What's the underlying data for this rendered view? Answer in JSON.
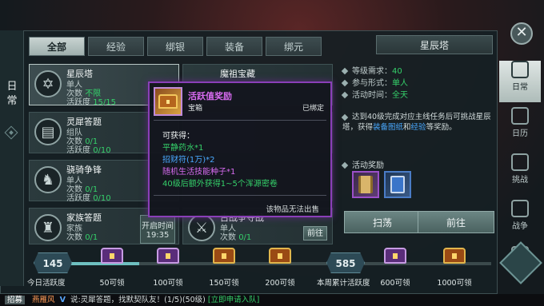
{
  "sidebar_title": "日常",
  "close_label": "✕",
  "tabs": [
    {
      "label": "全部",
      "active": true
    },
    {
      "label": "经验",
      "active": false
    },
    {
      "label": "绑银",
      "active": false
    },
    {
      "label": "装备",
      "active": false
    },
    {
      "label": "绑元",
      "active": false
    }
  ],
  "activities": [
    {
      "icon": "hexagram-icon",
      "glyph": "✡",
      "title": "星辰塔",
      "type": "单人",
      "count_label": "次数",
      "count": "不限",
      "act_label": "活跃度",
      "act": "15/15"
    },
    {
      "icon": "book-icon",
      "glyph": "📖",
      "title": "灵犀答题",
      "type": "组队",
      "count_label": "次数",
      "count": "0/1",
      "act_label": "活跃度",
      "act": "0/10"
    },
    {
      "icon": "horse-icon",
      "glyph": "♞",
      "title": "骁骑争锋",
      "type": "单人",
      "count_label": "次数",
      "count": "0/1",
      "act_label": "活跃度",
      "act": "0/10"
    },
    {
      "icon": "helmet-icon",
      "glyph": "♜",
      "title": "家族答题",
      "type": "家族",
      "count_label": "次数",
      "count": "0/1",
      "act_label": "活跃度",
      "act": "0/10",
      "time": "19:35"
    },
    {
      "title": "魔祖宝藏"
    },
    {
      "title": "古战争夺战",
      "type": "单人",
      "count_label": "次数",
      "count": "0/1"
    }
  ],
  "card_time_label": "开启时间",
  "go_label": "前往",
  "popup": {
    "name": "活跃值奖励",
    "type": "宝箱",
    "bound": "已绑定",
    "obtain_label": "可获得：",
    "rewards": [
      {
        "text": "平静药水*1",
        "color": "#35d06a"
      },
      {
        "text": "招财符(1万)*2",
        "color": "#4aa9ff"
      },
      {
        "text": "随机生活技能种子*1",
        "color": "#d76bf0"
      },
      {
        "text": "40级后额外获得1~5个浑源密卷",
        "color": "#35d06a"
      }
    ],
    "no_sell": "该物品无法出售"
  },
  "detail": {
    "title": "星辰塔",
    "level_label": "等级需求：",
    "level": "40",
    "form_label": "参与形式：",
    "form": "单人",
    "time_label": "活动时间：",
    "time": "全天",
    "desc_pre": "达到40级完成对应主线任务后可挑战星辰塔，获得",
    "desc_hl1": "装备图纸",
    "desc_mid": "和",
    "desc_hl2": "经验",
    "desc_post": "等奖励。",
    "rewards_label": "活动奖励",
    "sweep": "扫荡",
    "go": "前往"
  },
  "nav": [
    {
      "label": "日常",
      "icon": "calendar-scroll-icon",
      "active": true
    },
    {
      "label": "日历",
      "icon": "calendar-icon",
      "active": false
    },
    {
      "label": "挑战",
      "icon": "swords-icon",
      "active": false
    },
    {
      "label": "战争",
      "icon": "banner-icon",
      "active": false
    },
    {
      "label": "争夺",
      "icon": "crown-icon",
      "active": false
    }
  ],
  "progress": {
    "today_score": "145",
    "today_label": "今日活跃度",
    "week_score": "585",
    "week_label": "本周累计活跃度",
    "today_chests": [
      "50可领",
      "100可领",
      "150可领",
      "200可领"
    ],
    "week_chests": [
      "600可领",
      "1000可领"
    ]
  },
  "chat": {
    "channel": "招募",
    "sender": "燕雁风",
    "vip": "V",
    "message": "说:灵犀答题，找默契队友！(1/5)(50级)",
    "link": "[立即申请入队]"
  }
}
